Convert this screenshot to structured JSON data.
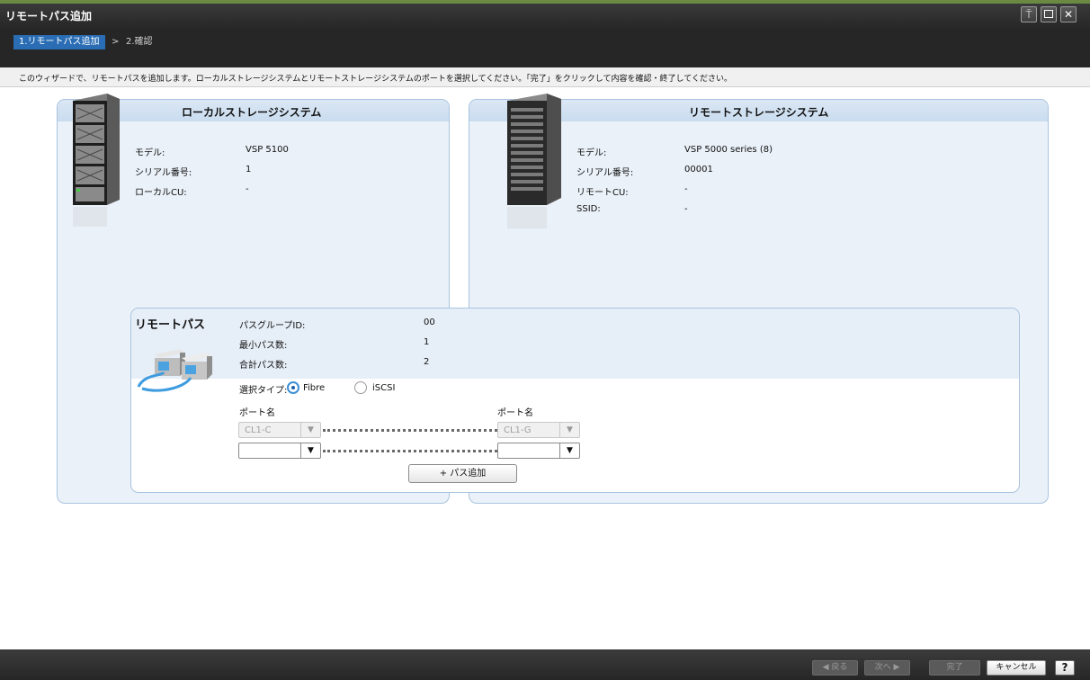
{
  "window": {
    "title": "リモートパス追加"
  },
  "steps": [
    {
      "label": "1.リモートパス追加",
      "active": true
    },
    {
      "label": "2.確認",
      "active": false
    }
  ],
  "step_separator": ">",
  "instruction": "このウィザードで、リモートパスを追加します。ローカルストレージシステムとリモートストレージシステムのポートを選択してください。「完了」をクリックして内容を確認・終了してください。",
  "local": {
    "header": "ローカルストレージシステム",
    "fields": [
      {
        "label": "モデル:",
        "value": "VSP 5100"
      },
      {
        "label": "シリアル番号:",
        "value": "1"
      },
      {
        "label": "ローカルCU:",
        "value": "-"
      }
    ]
  },
  "remote": {
    "header": "リモートストレージシステム",
    "fields": [
      {
        "label": "モデル:",
        "value": "VSP 5000 series (8)"
      },
      {
        "label": "シリアル番号:",
        "value": "00001"
      },
      {
        "label": "リモートCU:",
        "value": "-"
      },
      {
        "label": "SSID:",
        "value": "-"
      }
    ]
  },
  "remote_path": {
    "title": "リモートパス",
    "fields": [
      {
        "label": "パスグループID:",
        "value": "00"
      },
      {
        "label": "最小パス数:",
        "value": "1"
      },
      {
        "label": "合計パス数:",
        "value": "2"
      }
    ],
    "select_type_label": "選択タイプ:",
    "types": [
      {
        "label": "Fibre",
        "selected": true
      },
      {
        "label": "iSCSI",
        "selected": false
      }
    ],
    "local_port_label": "ポート名",
    "remote_port_label": "ポート名",
    "paths": [
      {
        "local_port": "CL1-C",
        "remote_port": "CL1-G",
        "disabled": true
      },
      {
        "local_port": "",
        "remote_port": "",
        "disabled": false
      }
    ],
    "add_path_button": "+ パス追加"
  },
  "footer": {
    "back": "◀ 戻る",
    "next": "次へ ▶",
    "finish": "完了",
    "cancel": "キャンセル",
    "help": "?"
  },
  "icons": {
    "pin": "pin-icon",
    "maximize": "maximize-icon",
    "close": "close-icon",
    "dropdown": "chevron-down-icon"
  },
  "colors": {
    "title_bar": "#2e2e2e",
    "active_step": "#2a6db4",
    "panel_border": "#a9c3df",
    "panel_bg": "#eaf1f8"
  }
}
